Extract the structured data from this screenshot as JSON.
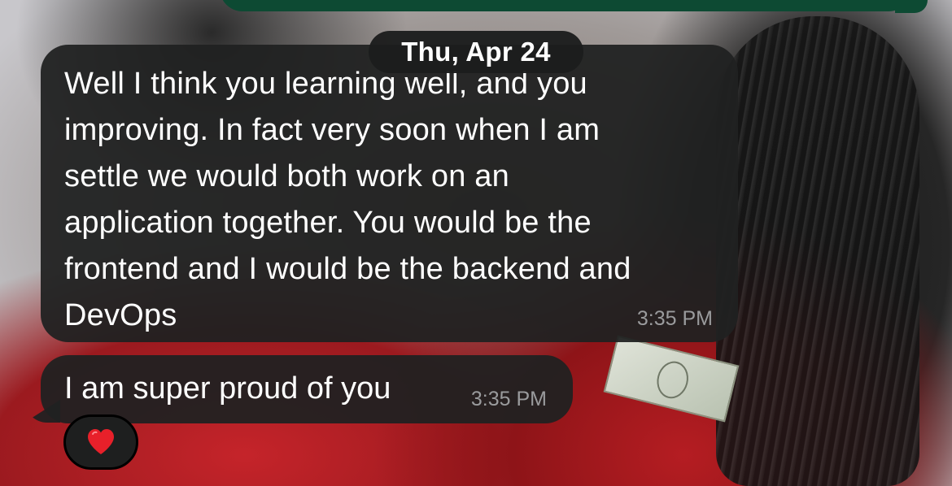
{
  "date_separator": "Thu, Apr 24",
  "messages": [
    {
      "text": "Well I think you learning well, and you\nimproving. In fact very soon when I am\nsettle we would both work on an\napplication together. You would be the\nfrontend and I would be the backend and\nDevOps",
      "time": "3:35 PM"
    },
    {
      "text": "I am super proud of you",
      "time": "3:35 PM"
    }
  ],
  "reaction": {
    "icon": "heart-icon",
    "color": "#e8202a"
  },
  "colors": {
    "incoming_bubble": "#202121",
    "outgoing_bubble": "#0d4a33",
    "timestamp": "#9a9b9d"
  }
}
